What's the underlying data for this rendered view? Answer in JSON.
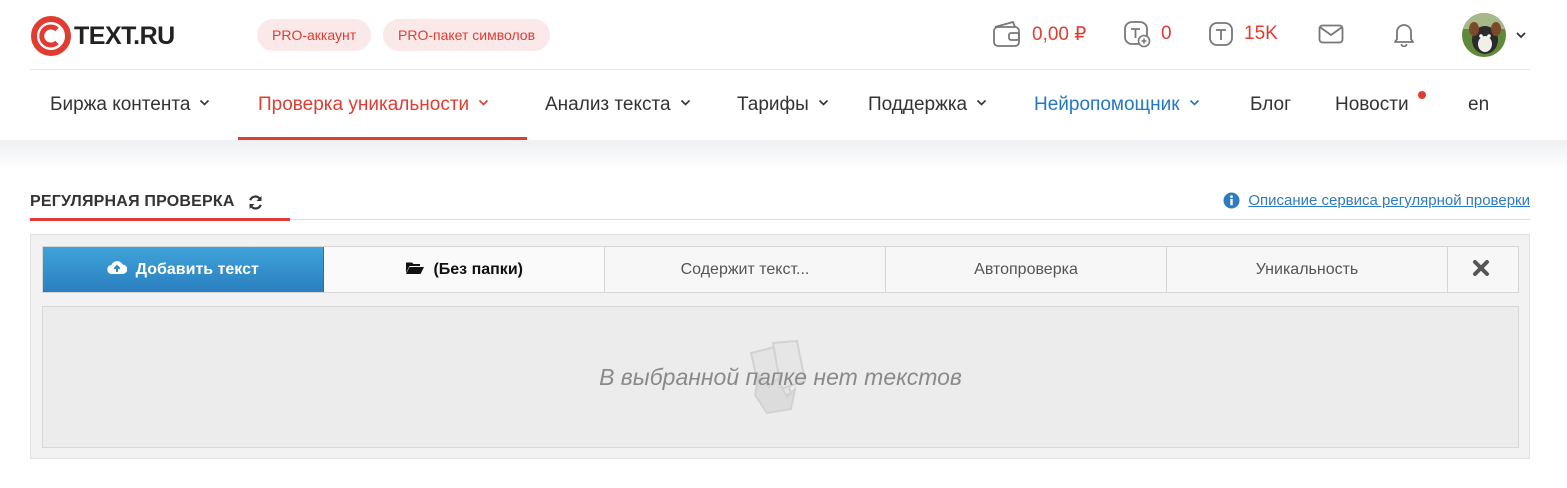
{
  "brand": {
    "logo_text": "TEXT.RU"
  },
  "header": {
    "pills": [
      "PRO-аккаунт",
      "PRO-пакет символов"
    ],
    "balance": "0,00 ₽",
    "tcoins_plus": "0",
    "tcoins": "15K",
    "icons": [
      "wallet-icon",
      "coin-plus-icon",
      "coin-icon",
      "mail-icon",
      "bell-icon",
      "chevron-down-icon"
    ]
  },
  "nav": {
    "items": [
      {
        "label": "Биржа контента",
        "state": "normal"
      },
      {
        "label": "Проверка уникальности",
        "state": "active"
      },
      {
        "label": "Анализ текста",
        "state": "normal"
      },
      {
        "label": "Тарифы",
        "state": "normal"
      },
      {
        "label": "Поддержка",
        "state": "normal"
      },
      {
        "label": "Нейропомощник",
        "state": "highlight"
      },
      {
        "label": "Блог",
        "state": "normal"
      },
      {
        "label": "Новости",
        "state": "notification"
      },
      {
        "label": "en",
        "state": "normal"
      }
    ]
  },
  "section": {
    "title": "РЕГУЛЯРНАЯ ПРОВЕРКА",
    "description_link": "Описание сервиса регулярной проверки"
  },
  "toolbar": {
    "add_label": "Добавить текст",
    "folder_label": "(Без папки)",
    "contains_label": "Содержит текст...",
    "autocheck_label": "Автопроверка",
    "uniqueness_label": "Уникальность"
  },
  "empty_state": {
    "message": "В выбранной папке нет текстов"
  },
  "colors": {
    "accent": "#e03c31",
    "link": "#2f7bbf",
    "button": "#2a7fbe",
    "nav_highlight": "#2277c7"
  }
}
